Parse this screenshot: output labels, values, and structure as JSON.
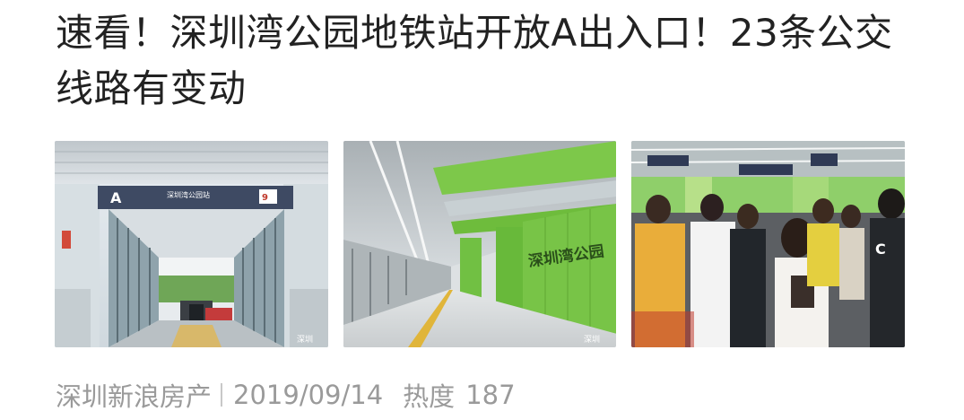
{
  "article": {
    "title": "速看！深圳湾公园地铁站开放A出入口！23条公交线路有变动",
    "images": [
      {
        "description_icon": "station-entrance-image",
        "sign_letter": "A",
        "sign_text": "深圳湾公园站",
        "line_badge": "9",
        "watermark": "深圳"
      },
      {
        "description_icon": "station-platform-image",
        "wall_text": "深圳湾公园",
        "watermark": "深圳"
      },
      {
        "description_icon": "crowded-concourse-image"
      }
    ],
    "meta": {
      "source": "深圳新浪房产",
      "date": "2019/09/14",
      "heat_label": "热度",
      "heat_value": "187"
    }
  },
  "colors": {
    "title": "#222222",
    "meta": "#9a9a9a",
    "platform_green": "#7dc84a"
  }
}
